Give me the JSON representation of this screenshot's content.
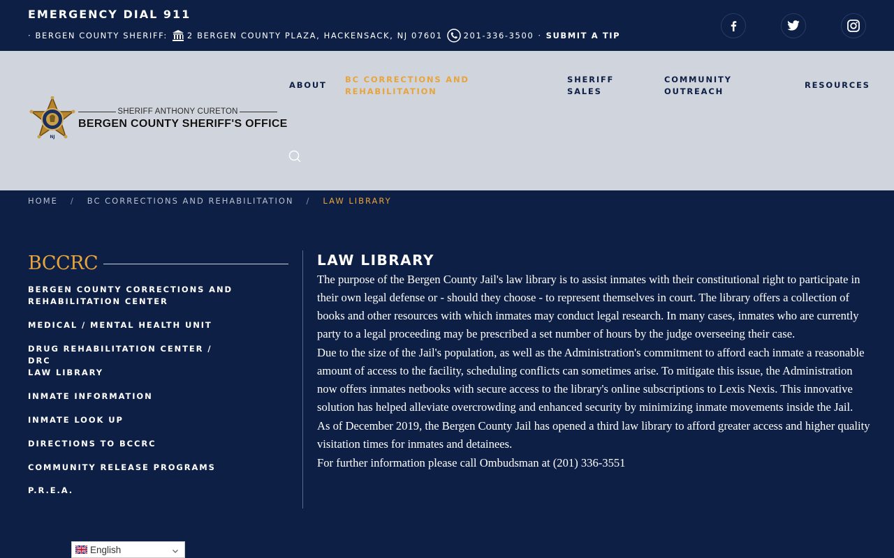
{
  "topbar": {
    "emergency": "EMERGENCY DIAL 911",
    "sheriff_prefix": "· BERGEN COUNTY SHERIFF:",
    "address": "2 BERGEN COUNTY PLAZA, HACKENSACK, NJ 07601",
    "phone": "201-336-3500",
    "dot": "·",
    "submit_tip": "SUBMIT A TIP",
    "social": [
      "facebook-icon",
      "twitter-icon",
      "instagram-icon"
    ]
  },
  "logo": {
    "subtitle": "SHERIFF ANTHONY CURETON",
    "title": "BERGEN COUNTY SHERIFF'S OFFICE",
    "badge_text": "NJ"
  },
  "nav": {
    "about": "ABOUT",
    "corrections_1": "BC CORRECTIONS AND",
    "corrections_2": "REHABILITATION",
    "sales_1": "SHERIFF",
    "sales_2": "SALES",
    "outreach_1": "COMMUNITY",
    "outreach_2": "OUTREACH",
    "resources": "RESOURCES"
  },
  "breadcrumb": {
    "home": "HOME",
    "sep": "/",
    "section": "BC CORRECTIONS AND REHABILITATION",
    "current": "LAW LIBRARY"
  },
  "sidebar": {
    "title": "BCCRC",
    "items": [
      {
        "line1": "BERGEN COUNTY CORRECTIONS AND",
        "line2": "REHABILITATION CENTER"
      },
      {
        "line1": "MEDICAL / MENTAL HEALTH UNIT"
      },
      {
        "line1": "DRUG REHABILITATION CENTER / DRC"
      },
      {
        "line1": "LAW LIBRARY"
      },
      {
        "line1": "INMATE INFORMATION"
      },
      {
        "line1": "INMATE LOOK UP"
      },
      {
        "line1": "DIRECTIONS TO BCCRC"
      },
      {
        "line1": "COMMUNITY RELEASE PROGRAMS"
      },
      {
        "line1": "P.R.E.A."
      }
    ]
  },
  "content": {
    "title": "LAW LIBRARY",
    "paragraphs": [
      "The purpose of the Bergen County Jail's law library is to assist inmates with their constitutional right to participate in their own legal defense or - should they choose - to represent themselves in court. The library offers a collection of books and other resources with which inmates may conduct legal research. In many cases, inmates who are currently party to a legal proceeding may be prescribed a set number of hours by the judge overseeing their case.",
      "Due to the size of the Jail's population, as well as the Administration's commitment to afford each inmate a reasonable amount of access to the facility, scheduling conflicts can sometimes arise. To mitigate this issue, the Administration now offers inmates netbooks with secure access to the library's online subscriptions to Lexis Nexis. This innovative solution has helped alleviate overcrowding and enhanced security by minimizing inmate movements inside the Jail.",
      "As of December 2019, the Bergen County Jail has opened a third law library to afford greater access and higher quality visitation times for inmates and detainees.",
      "For further information please call Ombudsman at (201) 336-3551"
    ]
  },
  "translate": {
    "language": "English"
  },
  "colors": {
    "navy": "#0e1f45",
    "accent": "#e8a43c",
    "header_bg": "#d0d4dd"
  }
}
